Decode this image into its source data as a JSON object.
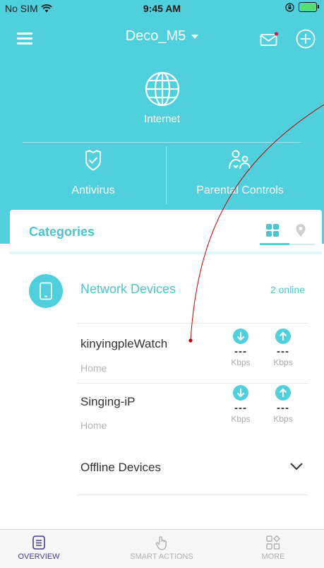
{
  "status_bar": {
    "carrier": "No SIM",
    "time": "9:45 AM"
  },
  "header": {
    "network_name": "Deco_M5",
    "icons": [
      "menu-icon",
      "mail-icon",
      "add-icon"
    ]
  },
  "internet": {
    "label": "Internet",
    "icon": "globe-icon"
  },
  "features": [
    {
      "label": "Antivirus",
      "icon": "shield-icon"
    },
    {
      "label": "Parental Controls",
      "icon": "family-icon"
    }
  ],
  "categories": {
    "title": "Categories",
    "view_toggle": [
      "grid-view-icon",
      "location-pin-icon"
    ],
    "group": {
      "title": "Network Devices",
      "status": "2 online",
      "icon": "phone-icon"
    },
    "devices": [
      {
        "name": "kinyingpleWatch",
        "group": "Home",
        "download": "---",
        "upload": "---",
        "download_unit": "Kbps",
        "upload_unit": "Kbps"
      },
      {
        "name": "Singing-iP",
        "group": "Home",
        "download": "---",
        "upload": "---",
        "download_unit": "Kbps",
        "upload_unit": "Kbps"
      }
    ],
    "offline_label": "Offline Devices"
  },
  "tabbar": {
    "tabs": [
      {
        "label": "OVERVIEW",
        "active": true
      },
      {
        "label": "SMART ACTIONS",
        "active": false
      },
      {
        "label": "MORE",
        "active": false
      }
    ]
  },
  "colors": {
    "accent": "#4fd0dc",
    "accent_text": "#4fc3d0",
    "active_tab": "#4a3a8a",
    "annotation": "#c00000"
  }
}
